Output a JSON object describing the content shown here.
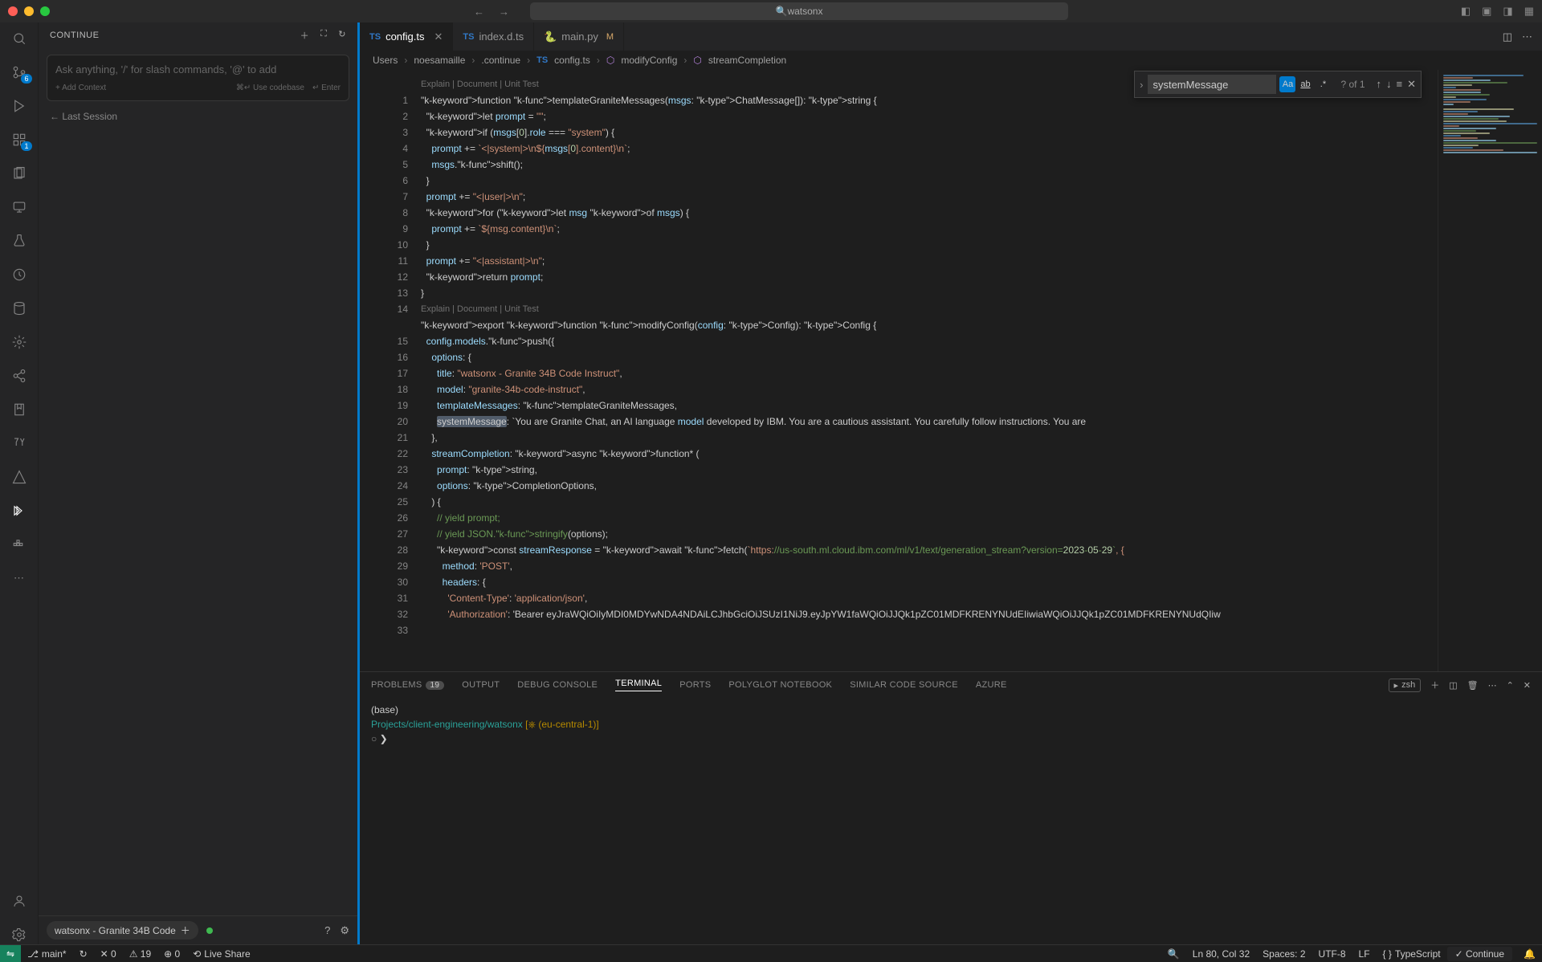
{
  "title_search": "watsonx",
  "sidebar": {
    "title": "CONTINUE",
    "input_placeholder": "Ask anything, '/' for slash commands, '@' to add",
    "add_context": "+ Add Context",
    "use_codebase": "⌘↵ Use codebase",
    "enter": "↵ Enter",
    "last_session": "← Last Session",
    "model": "watsonx - Granite 34B Code"
  },
  "activity_badges": {
    "git": "6",
    "ext": "1"
  },
  "tabs": [
    {
      "icon": "TS",
      "name": "config.ts",
      "active": true,
      "close": true
    },
    {
      "icon": "TS",
      "name": "index.d.ts",
      "active": false
    },
    {
      "icon": "py",
      "name": "main.py",
      "modified": "M",
      "active": false
    }
  ],
  "breadcrumb": [
    "Users",
    "noesamaille",
    ".continue",
    "config.ts",
    "modifyConfig",
    "streamCompletion"
  ],
  "find": {
    "value": "systemMessage",
    "result": "? of 1"
  },
  "codelens": "Explain | Document | Unit Test",
  "code_lines": [
    "function templateGraniteMessages(msgs: ChatMessage[]): string {",
    "  let prompt = \"\";",
    "  if (msgs[0].role === \"system\") {",
    "    prompt += `<|system|>\\n${msgs[0].content}\\n`;",
    "    msgs.shift();",
    "  }",
    "  prompt += \"<|user|>\\n\";",
    "  for (let msg of msgs) {",
    "    prompt += `${msg.content}\\n`;",
    "  }",
    "  prompt += \"<|assistant|>\\n\";",
    "  return prompt;",
    "}",
    "",
    "export function modifyConfig(config: Config): Config {",
    "  config.models.push({",
    "    options: {",
    "      title: \"watsonx - Granite 34B Code Instruct\",",
    "      model: \"granite-34b-code-instruct\",",
    "      templateMessages: templateGraniteMessages,",
    "      systemMessage: `You are Granite Chat, an AI language model developed by IBM. You are a cautious assistant. You carefully follow instructions. You are",
    "    },",
    "    streamCompletion: async function* (",
    "      prompt: string,",
    "      options: CompletionOptions,",
    "    ) {",
    "      // yield prompt;",
    "      // yield JSON.stringify(options);",
    "      const streamResponse = await fetch(`https://us-south.ml.cloud.ibm.com/ml/v1/text/generation_stream?version=2023-05-29`, {",
    "        method: 'POST',",
    "        headers: {",
    "          'Content-Type': 'application/json',",
    "          'Authorization': 'Bearer eyJraWQiOiIyMDI0MDYwNDA4NDAiLCJhbGciOiJSUzI1NiJ9.eyJpYW1faWQiOiJJQk1pZC01MDFKRENYNUdEIiwiaWQiOiJJQk1pZC01MDFKRENYNUdQIiw"
  ],
  "panel": {
    "tabs": [
      "PROBLEMS",
      "OUTPUT",
      "DEBUG CONSOLE",
      "TERMINAL",
      "PORTS",
      "POLYGLOT NOTEBOOK",
      "SIMILAR CODE SOURCE",
      "AZURE"
    ],
    "problems_count": "19",
    "active": "TERMINAL",
    "shell": "zsh"
  },
  "terminal": {
    "l1": "(base)",
    "l2a": "Projects/client-engineering/watsonx",
    "l2b": "[⎈  (eu-central-1)]",
    "prompt": "❯ "
  },
  "status": {
    "branch": "main*",
    "sync": "↻",
    "errors": "✕ 0",
    "warnings": "⚠ 19",
    "ports": "⊕ 0",
    "live_share": "Live Share",
    "cursor": "Ln 80, Col 32",
    "spaces": "Spaces: 2",
    "encoding": "UTF-8",
    "eol": "LF",
    "lang": "TypeScript",
    "continue": "✓ Continue",
    "bell": "🔔"
  }
}
